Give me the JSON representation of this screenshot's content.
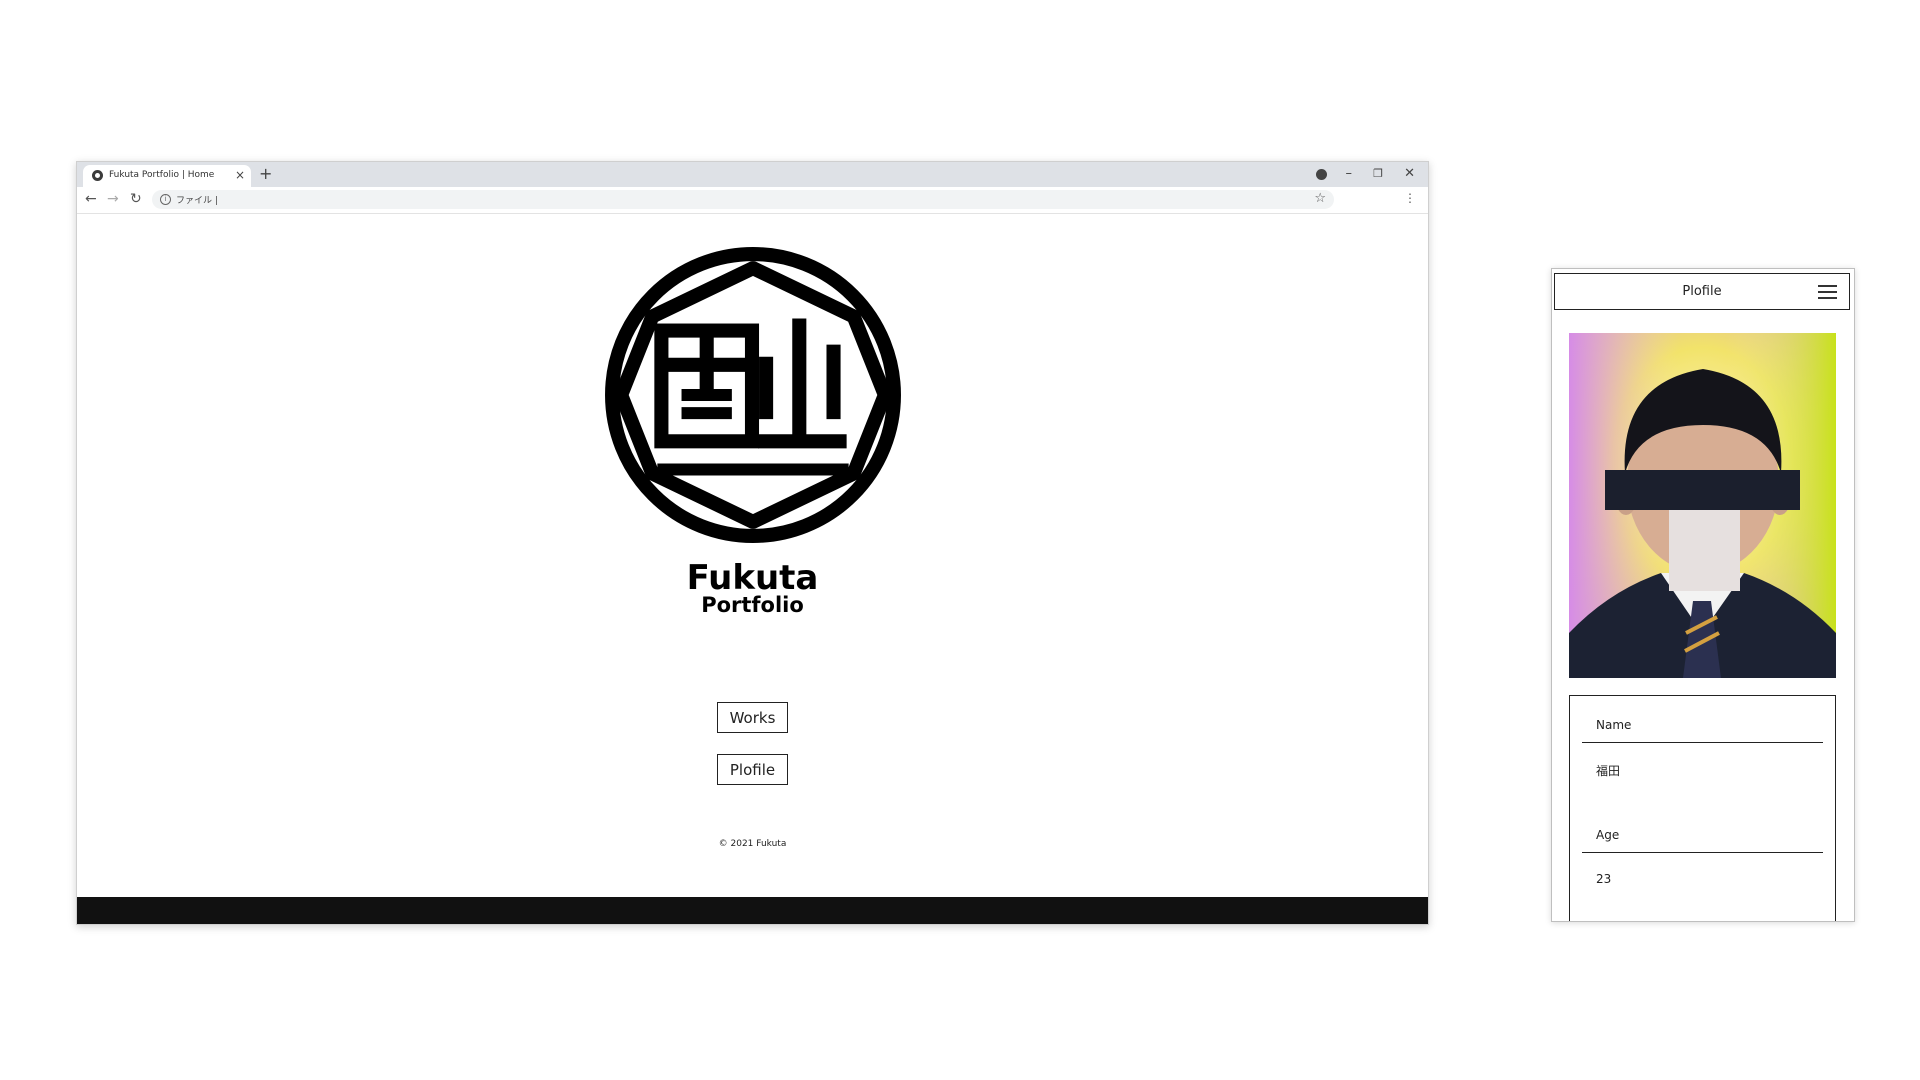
{
  "browser": {
    "tab_title": "Fukuta Portfolio | Home",
    "tab_close": "×",
    "new_tab": "+",
    "address_prefix": "ファイル |",
    "controls": {
      "minimize": "–",
      "maximize": "❐",
      "close": "✕"
    },
    "nav": {
      "back": "←",
      "forward": "→",
      "reload": "↻",
      "bookmark": "☆",
      "menu": "⋮"
    }
  },
  "site": {
    "logo_icon": "circular-family-crest-logo",
    "title": "Fukuta",
    "subtitle": "Portfolio",
    "nav": [
      {
        "label": "Works"
      },
      {
        "label": "Plofile"
      }
    ],
    "copyright": "© 2021 Fukuta"
  },
  "mobile": {
    "header_title": "Plofile",
    "menu_icon": "hamburger-icon",
    "photo": "profile-photo-redacted",
    "fields": [
      {
        "label": "Name",
        "value": "福田"
      },
      {
        "label": "Age",
        "value": "23"
      }
    ]
  },
  "colors": {
    "footer": "#111111",
    "tabbar": "#dee1e6",
    "ink": "#000000"
  }
}
